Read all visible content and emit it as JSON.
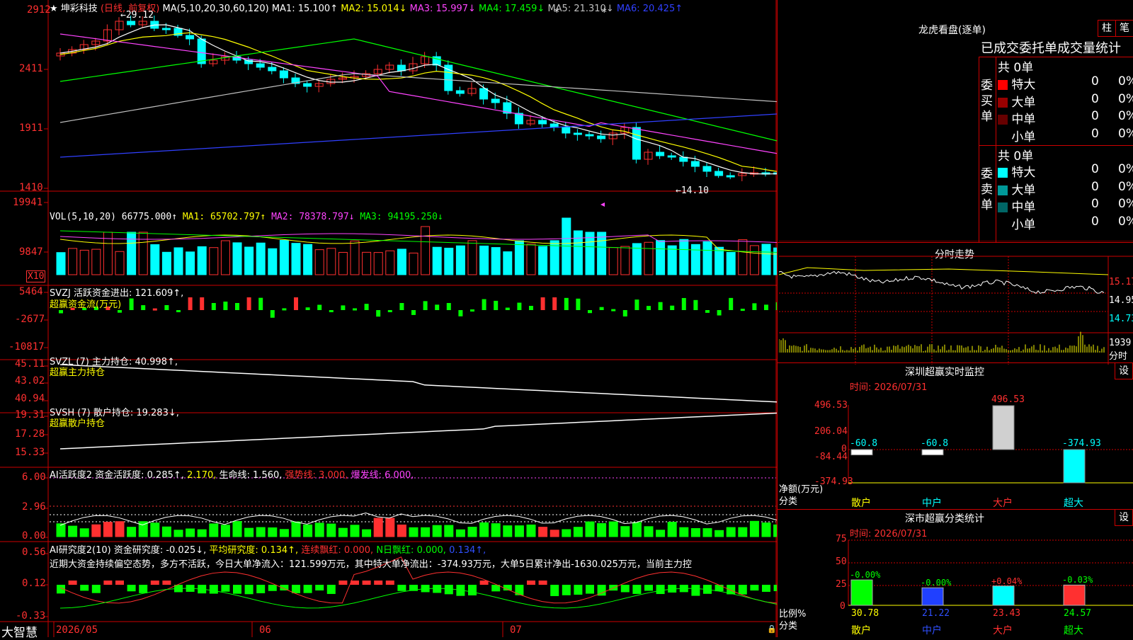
{
  "stock": {
    "name": "★ 坤彩科技",
    "period": "(日线, 前复权)"
  },
  "main_ma": {
    "label": "MA(5,10,20,30,60,120)",
    "items": [
      {
        "text": "MA1: 15.100↑",
        "color": "#ffffff"
      },
      {
        "text": "MA2: 15.014↓",
        "color": "#ffff00"
      },
      {
        "text": "MA3: 15.997↓",
        "color": "#ff44ff"
      },
      {
        "text": "MA4: 17.459↓",
        "color": "#00ff00"
      },
      {
        "text": "MA5: 21.310↓",
        "color": "#c0c0c0"
      },
      {
        "text": "MA6: 20.425↑",
        "color": "#3040ff"
      }
    ]
  },
  "main_axis": [
    "2912",
    "2411",
    "1911",
    "1410"
  ],
  "high_note": "←29.12",
  "low_note": "←14.10",
  "vol": {
    "label": "VOL(5,10,20)",
    "value": "66775.000↑",
    "items": [
      {
        "text": "MA1: 65702.797↑",
        "color": "#ffff00"
      },
      {
        "text": "MA2: 78378.797↓",
        "color": "#ff44ff"
      },
      {
        "text": "MA3: 94195.250↓",
        "color": "#00ff00"
      }
    ],
    "axis": [
      "19941",
      "9847"
    ],
    "unit": "X10"
  },
  "svzj": {
    "line1": "SVZJ  活跃资金进出: 121.609↑,",
    "line2": "超赢资金流(万元)",
    "axis": [
      "5464",
      "-2677",
      "-10817"
    ]
  },
  "svzl": {
    "line1": "SVZL (7) 主力持仓: 40.998↑,",
    "line2": "超赢主力持仓",
    "axis": [
      "45.11",
      "43.02",
      "40.94"
    ]
  },
  "svsh": {
    "line1": "SVSH (7) 散户持仓: 19.283↓,",
    "line2": "超赢散户持仓",
    "axis": [
      "19.31",
      "17.28",
      "15.33"
    ]
  },
  "ai_active": {
    "prefix": "AI活跃度2 资金活跃度: 0.285↑,",
    "v2": "2.170,",
    "v3": "生命线: 1.560,",
    "v4": "强势线: 3.000,",
    "v5": "爆发线: 6.000,",
    "axis": [
      "6.00",
      "2.96",
      "0.00"
    ]
  },
  "ai_research": {
    "prefix": "AI研究度2(10) 资金研究度: -0.025↓,",
    "v2": "平均研究度: 0.134↑,",
    "v3": "连续飘红: 0.000,",
    "v4": "N日飘红: 0.000,",
    "v5": "0.134↑,",
    "commentary": "近期大资金持续偏空态势，多方不活跃，今日大单净流入：121.599万元，其中特大单净流出：-374.93万元，大单5日累计净出-1630.025万元，当前主力控",
    "axis": [
      "0.56",
      "0.12",
      "-0.33"
    ]
  },
  "footer": {
    "brand": "大智慧",
    "dates": [
      "2026/05",
      "06",
      "07"
    ]
  },
  "lhb": {
    "title": "龙虎看盘(逐单)",
    "btn1": "柱",
    "btn2": "笔",
    "header": "已成交委托单成交量统计",
    "buy": {
      "side": "委买单",
      "total": "共 0单",
      "rows": [
        {
          "label": "特大",
          "v": "0",
          "p": "0%",
          "color": "#ff0000"
        },
        {
          "label": "大单",
          "v": "0",
          "p": "0%",
          "color": "#990000"
        },
        {
          "label": "中单",
          "v": "0",
          "p": "0%",
          "color": "#660000"
        },
        {
          "label": "小单",
          "v": "0",
          "p": "0%",
          "color": ""
        }
      ]
    },
    "sell": {
      "side": "委卖单",
      "total": "共 0单",
      "rows": [
        {
          "label": "特大",
          "v": "0",
          "p": "0%",
          "color": "#00ffff"
        },
        {
          "label": "大单",
          "v": "0",
          "p": "0%",
          "color": "#009999"
        },
        {
          "label": "中单",
          "v": "0",
          "p": "0%",
          "color": "#006666"
        },
        {
          "label": "小单",
          "v": "0",
          "p": "0%",
          "color": ""
        }
      ]
    }
  },
  "intraday": {
    "title": "分时走势",
    "prices": [
      "15.17",
      "14.95",
      "14.73"
    ],
    "vol": "1939",
    "vol_label": "分时"
  },
  "monitor": {
    "title": "深圳超赢实时监控",
    "btn": "设",
    "time": "时间: 2026/07/31",
    "axis": [
      "496.53",
      "206.04",
      "0",
      "-84.44",
      "-374.93"
    ],
    "ylabel1": "净额(万元)",
    "ylabel2": "分类",
    "bars": [
      {
        "cat": "散户",
        "value": "-60.8",
        "num": -60.8,
        "color": "#ffff00",
        "fill": "#ffffff"
      },
      {
        "cat": "中户",
        "value": "-60.8",
        "num": -60.8,
        "color": "#00ffff",
        "fill": "#ffffff"
      },
      {
        "cat": "大户",
        "value": "496.53",
        "num": 496.53,
        "color": "#ff3030",
        "fill": "#d0d0d0"
      },
      {
        "cat": "超大",
        "value": "-374.93",
        "num": -374.93,
        "color": "#00ffff",
        "fill": "#00ffff"
      }
    ]
  },
  "classify": {
    "title": "深市超赢分类统计",
    "btn": "设",
    "time": "时间: 2026/07/31",
    "axis": [
      "75",
      "50",
      "25",
      "0"
    ],
    "ylabel1": "比例%",
    "ylabel2": "分类",
    "bars": [
      {
        "cat": "散户",
        "pct": 30.78,
        "value": "30.78",
        "change": "-0.00%",
        "color": "#ffff00",
        "fill": "#00ff00"
      },
      {
        "cat": "中户",
        "pct": 21.22,
        "value": "21.22",
        "change": "-0.00%",
        "color": "#3050ff",
        "fill": "#2040ff"
      },
      {
        "cat": "大户",
        "pct": 23.43,
        "value": "23.43",
        "change": "+0.04%",
        "color": "#ff3030",
        "fill": "#00ffff"
      },
      {
        "cat": "超大",
        "pct": 24.57,
        "value": "24.57",
        "change": "-0.03%",
        "color": "#00ff00",
        "fill": "#ff3030"
      }
    ]
  }
}
